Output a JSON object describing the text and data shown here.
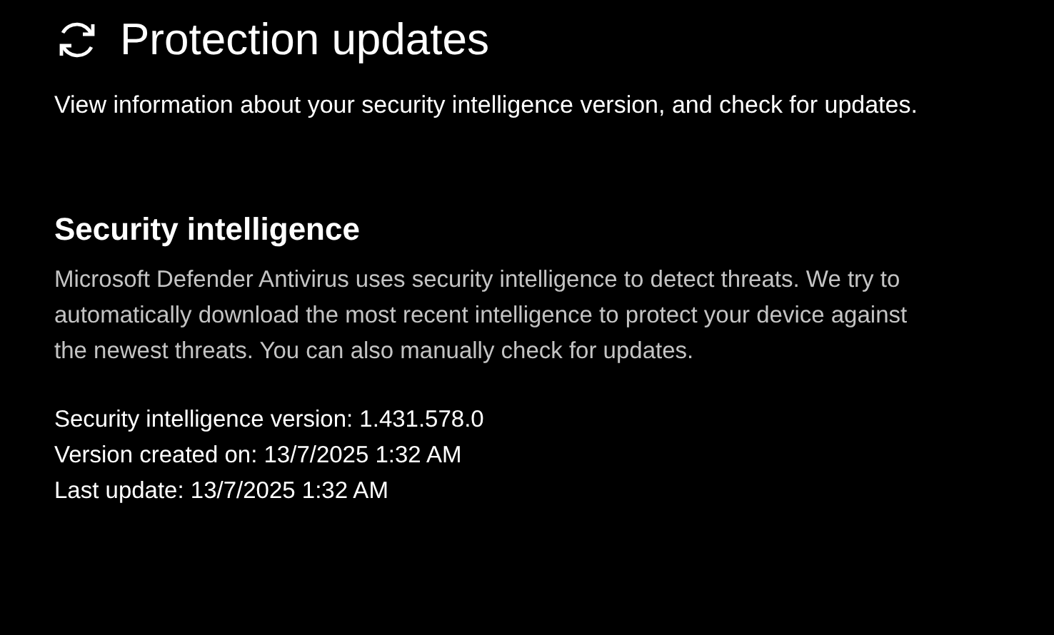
{
  "header": {
    "title": "Protection updates",
    "description": "View information about your security intelligence version, and check for updates."
  },
  "section": {
    "heading": "Security intelligence",
    "body": "Microsoft Defender Antivirus uses security intelligence to detect threats. We try to automatically download the most recent intelligence to protect your device against the newest threats. You can also manually check for updates."
  },
  "info_lines": [
    "Security intelligence version: 1.431.578.0",
    "Version created on: 13/7/2025 1:32 AM",
    "Last update: 13/7/2025 1:32 AM"
  ]
}
